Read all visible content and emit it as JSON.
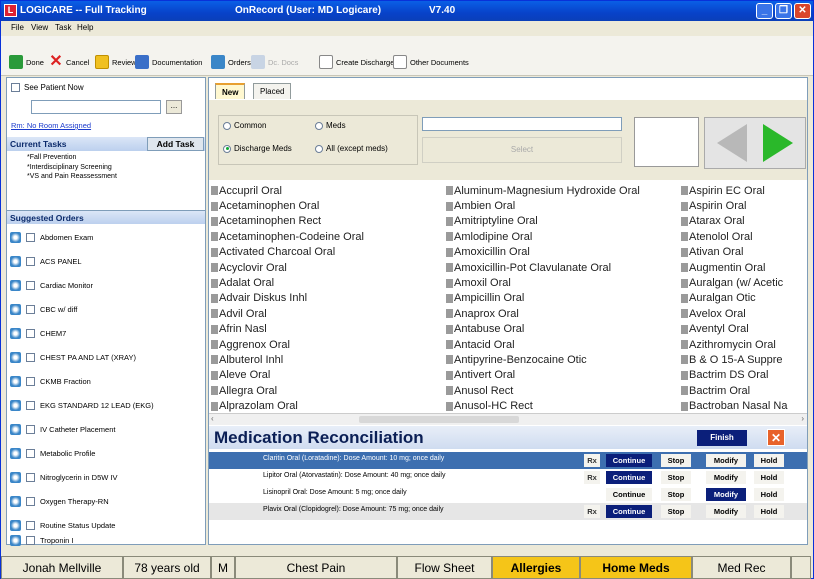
{
  "window": {
    "app_title": "LOGICARE -- Full Tracking",
    "record_title": "OnRecord (User: MD Logicare)",
    "version": "V7.40"
  },
  "menu": [
    "File",
    "View",
    "Task",
    "Help"
  ],
  "toolbar": {
    "done": "Done",
    "cancel": "Cancel",
    "review": "Review",
    "documentation": "Documentation",
    "orders": "Orders",
    "dc_docs": "Dc. Docs",
    "create_discharge": "Create Discharge",
    "other_documents": "Other Documents"
  },
  "left": {
    "see_patient_now": "See Patient Now",
    "room_link": "Rm: No Room Assigned",
    "ellipsis": "...",
    "current_tasks": "Current Tasks",
    "add_task": "Add Task",
    "tasks": [
      "*Fall Prevention",
      "*Interdisciplinary Screening",
      "*VS and Pain Reassessment"
    ],
    "suggested_orders": "Suggested Orders",
    "orders": [
      "Abdomen Exam",
      "ACS PANEL",
      "Cardiac Monitor",
      "CBC w/ diff",
      "CHEM7",
      "CHEST PA AND LAT (XRAY)",
      "CKMB Fraction",
      "EKG STANDARD 12 LEAD (EKG)",
      "IV Catheter Placement",
      "Metabolic Profile",
      "Nitroglycerin in D5W IV",
      "Oxygen Therapy-RN",
      "Routine Status Update",
      "Troponin I"
    ]
  },
  "tabs": {
    "new": "New",
    "placed": "Placed"
  },
  "filters": {
    "common": "Common",
    "meds": "Meds",
    "discharge_meds": "Discharge Meds",
    "all_except_meds": "All (except meds)",
    "select": "Select"
  },
  "meds": {
    "col1": [
      "Accupril Oral",
      "Acetaminophen Oral",
      "Acetaminophen Rect",
      "Acetaminophen-Codeine Oral",
      "Activated Charcoal Oral",
      "Acyclovir Oral",
      "Adalat Oral",
      "Advair Diskus Inhl",
      "Advil Oral",
      "Afrin Nasl",
      "Aggrenox Oral",
      "Albuterol Inhl",
      "Aleve Oral",
      "Allegra Oral",
      "Alprazolam Oral"
    ],
    "col2": [
      "Aluminum-Magnesium Hydroxide Oral",
      "Ambien Oral",
      "Amitriptyline Oral",
      "Amlodipine Oral",
      "Amoxicillin Oral",
      "Amoxicillin-Pot Clavulanate Oral",
      "Amoxil Oral",
      "Ampicillin Oral",
      "Anaprox Oral",
      "Antabuse Oral",
      "Antacid Oral",
      "Antipyrine-Benzocaine Otic",
      "Antivert Oral",
      "Anusol Rect",
      "Anusol-HC Rect"
    ],
    "col3": [
      "Aspirin EC Oral",
      "Aspirin Oral",
      "Atarax Oral",
      "Atenolol Oral",
      "Ativan Oral",
      "Augmentin Oral",
      "Auralgan (w/ Acetic",
      "Auralgan Otic",
      "Avelox Oral",
      "Aventyl Oral",
      "Azithromycin Oral",
      "B & O 15-A Suppre",
      "Bactrim DS Oral",
      "Bactrim Oral",
      "Bactroban Nasal Na"
    ]
  },
  "medrec": {
    "title": "Medication Reconciliation",
    "finish": "Finish",
    "rows": [
      {
        "text": "Claritin Oral (Loratadine): Dose Amount:  10 mg;  once daily",
        "rx": "Rx",
        "cont": "Continue",
        "stop": "Stop",
        "mod": "Modify",
        "hold": "Hold"
      },
      {
        "text": "Lipitor Oral (Atorvastatin): Dose Amount:  40 mg;  once daily",
        "rx": "Rx",
        "cont": "Continue",
        "stop": "Stop",
        "mod": "Modify",
        "hold": "Hold"
      },
      {
        "text": "Lisinopril Oral: Dose Amount:  5 mg;  once daily",
        "rx": "",
        "cont": "Continue",
        "stop": "Stop",
        "mod": "Modify",
        "hold": "Hold"
      },
      {
        "text": "Plavix Oral (Clopidogrel): Dose Amount:  75 mg;  once daily",
        "rx": "Rx",
        "cont": "Continue",
        "stop": "Stop",
        "mod": "Modify",
        "hold": "Hold"
      }
    ]
  },
  "status": {
    "name": "Jonah Mellville",
    "age": "78 years old",
    "sex": "M",
    "complaint": "Chest Pain",
    "flow_sheet": "Flow Sheet",
    "allergies": "Allergies",
    "home_meds": "Home Meds",
    "med_rec": "Med Rec"
  },
  "colors": {
    "title_blue": "#0842c9",
    "alert_yellow": "#f5c518",
    "navy": "#0b1f7a"
  }
}
